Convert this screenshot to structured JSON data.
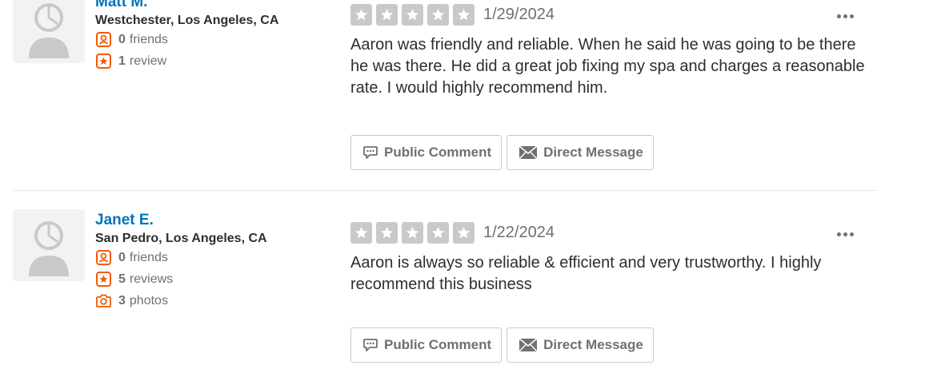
{
  "colors": {
    "accent": "#0073bb",
    "orange": "#f15c00",
    "star_gray": "#c8c9ca",
    "text_gray": "#6e7072"
  },
  "reviews": [
    {
      "user": {
        "name": "Matt M.",
        "location": "Westchester, Los Angeles, CA"
      },
      "stats": [
        {
          "icon": "friends-icon",
          "count": "0",
          "label": "friends"
        },
        {
          "icon": "review-star-icon",
          "count": "1",
          "label": "review"
        }
      ],
      "rating": 0,
      "date": "1/29/2024",
      "text": "Aaron was friendly and reliable. When he said he was going to be there he was there.  He did a great job fixing my spa and charges a reasonable rate. I would highly recommend him.",
      "buttons": {
        "comment": "Public Comment",
        "message": "Direct Message"
      }
    },
    {
      "user": {
        "name": "Janet E.",
        "location": "San Pedro, Los Angeles, CA"
      },
      "stats": [
        {
          "icon": "friends-icon",
          "count": "0",
          "label": "friends"
        },
        {
          "icon": "review-star-icon",
          "count": "5",
          "label": "reviews"
        },
        {
          "icon": "camera-icon",
          "count": "3",
          "label": "photos"
        }
      ],
      "rating": 0,
      "date": "1/22/2024",
      "text": "Aaron is always so reliable & efficient and very trustworthy. I highly recommend this business",
      "buttons": {
        "comment": "Public Comment",
        "message": "Direct Message"
      }
    }
  ]
}
